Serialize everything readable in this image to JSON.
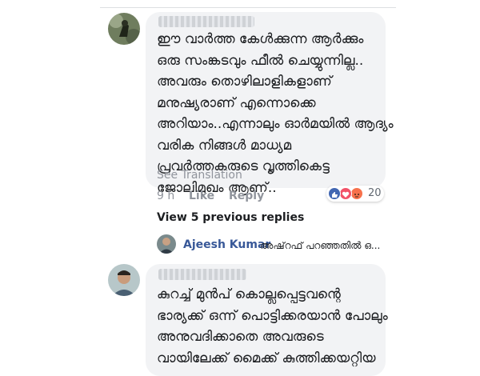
{
  "comment1": {
    "lines": [
      "ഈ വാർത്ത കേൾക്കുന്ന ആർക്കും",
      "ഒരു സംങ്കടവും ഫീൽ ചെയ്യുന്നില്ല..",
      "അവരും തൊഴിലാളികളാണ്",
      "മനുഷ്യരാണ് എന്നൊക്കെ",
      "അറിയാം..എന്നാലും ഓർമയിൽ ആദ്യം",
      "വരിക നിങ്ങൾ മാധ്യമ",
      "പ്രവർത്തകരുടെ വൃത്തികെട്ട",
      "ജോലിമുഖം ആണ്.."
    ],
    "see_translation": "See Translation",
    "time": "9 h",
    "like": "Like",
    "reply": "Reply",
    "reaction_count": "20",
    "reactions": [
      "like-icon",
      "love-icon",
      "angry-icon"
    ],
    "colors": {
      "like": "#4267b2",
      "love": "#f25268",
      "angry": "#f7714c"
    }
  },
  "view_previous_replies": "View 5 previous replies",
  "latest_reply": {
    "name": "Ajeesh Kumar",
    "snippet": "അഷ്‌റഫ് പറഞ്ഞതിൽ ഒ..."
  },
  "comment2": {
    "lines": [
      "കുറച്ച് മുൻപ് കൊല്ലപ്പെട്ടവന്റെ",
      "ഭാര്യക്ക് ഒന്ന് പൊട്ടിക്കരയാൻ പോലും",
      "അനുവദിക്കാതെ അവരുടെ",
      "വായിലേക്ക് മൈക്ക് കുത്തിക്കയറ്റിയ"
    ]
  }
}
